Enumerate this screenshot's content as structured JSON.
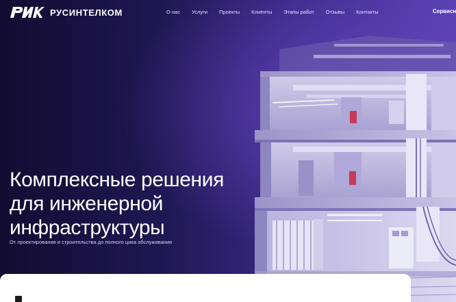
{
  "header": {
    "logo_text": "РУСИНТЕЛКОМ",
    "nav": [
      "О нас",
      "Услуги",
      "Проекты",
      "Клиенты",
      "Этапы работ",
      "Отзывы",
      "Контакты"
    ],
    "service_link": "Сервисн"
  },
  "hero": {
    "headline_lines": [
      "Комплексные решения",
      "для инженерной",
      "инфраструктуры"
    ],
    "subline": "От проектирования и строительства до полного цика обслуживания"
  },
  "colors": {
    "background_dark": "#120c32",
    "background_accent": "#5b42b3",
    "text": "#ffffff"
  }
}
